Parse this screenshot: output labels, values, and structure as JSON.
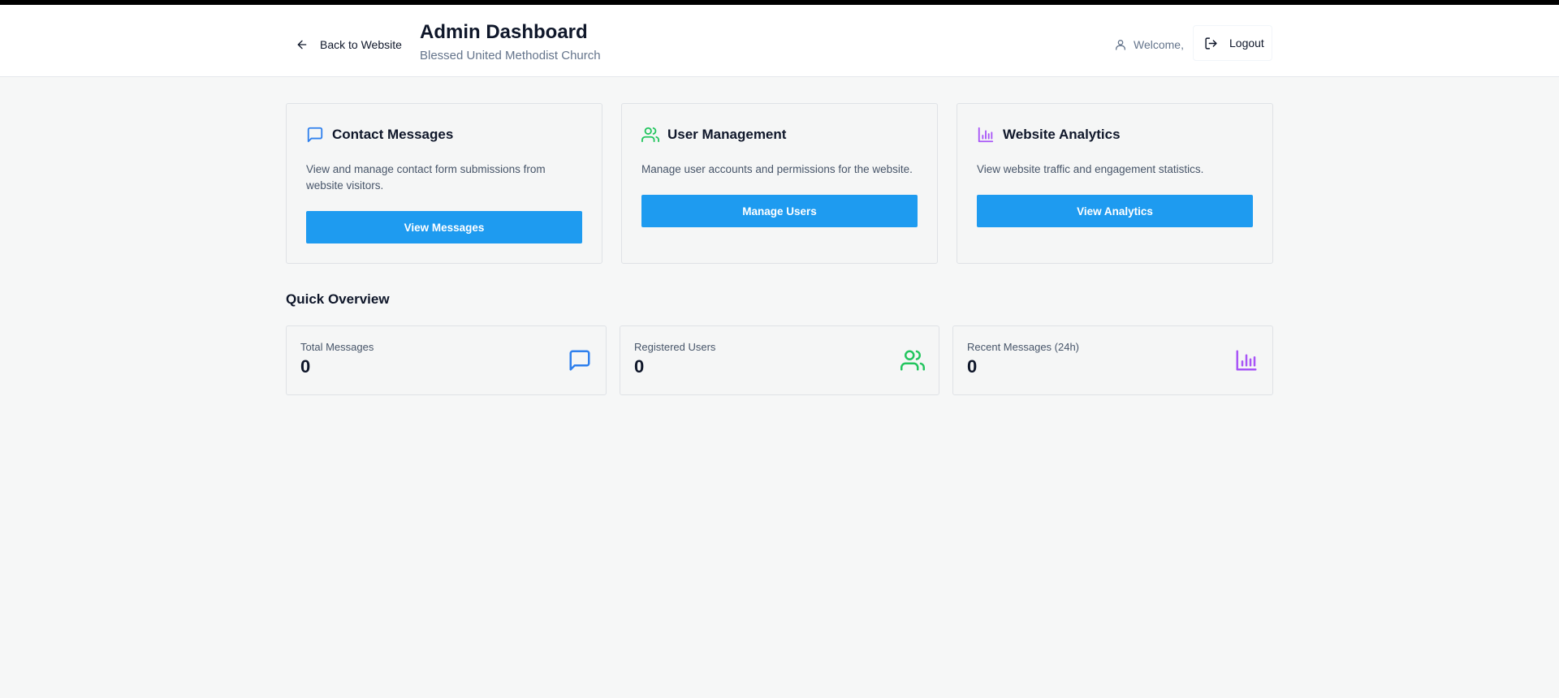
{
  "header": {
    "back_label": "Back to Website",
    "title": "Admin Dashboard",
    "subtitle": "Blessed United Methodist Church",
    "welcome_label": "Welcome,",
    "logout_label": "Logout"
  },
  "cards": [
    {
      "title": "Contact Messages",
      "description": "View and manage contact form submissions from website visitors.",
      "button_label": "View Messages",
      "icon": "message-square-icon",
      "color": "#2f80ed"
    },
    {
      "title": "User Management",
      "description": "Manage user accounts and permissions for the website.",
      "button_label": "Manage Users",
      "icon": "users-icon",
      "color": "#22c55e"
    },
    {
      "title": "Website Analytics",
      "description": "View website traffic and engagement statistics.",
      "button_label": "View Analytics",
      "icon": "bar-chart-icon",
      "color": "#a855f7"
    }
  ],
  "overview": {
    "title": "Quick Overview",
    "stats": [
      {
        "label": "Total Messages",
        "value": "0",
        "icon": "message-square-icon",
        "color": "#2f80ed"
      },
      {
        "label": "Registered Users",
        "value": "0",
        "icon": "users-icon",
        "color": "#22c55e"
      },
      {
        "label": "Recent Messages (24h)",
        "value": "0",
        "icon": "bar-chart-icon",
        "color": "#a855f7"
      }
    ]
  },
  "colors": {
    "primary_button": "#1e9bf0",
    "background": "#f6f7f7"
  }
}
